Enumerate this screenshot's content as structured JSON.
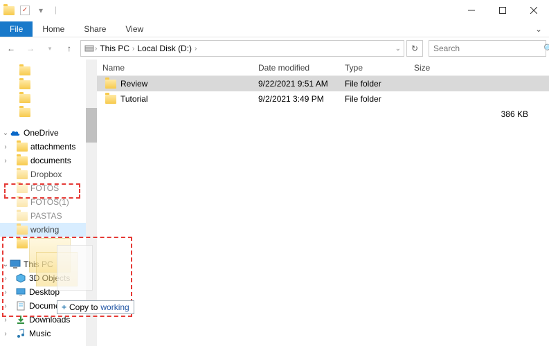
{
  "titlebar": {
    "qat": [
      "folder",
      "check",
      "pipe"
    ]
  },
  "ribbon": {
    "file": "File",
    "home": "Home",
    "share": "Share",
    "view": "View"
  },
  "nav": {
    "breadcrumb": [
      "This PC",
      "Local Disk (D:)"
    ],
    "search_placeholder": "Search"
  },
  "columns": {
    "name": "Name",
    "date": "Date modified",
    "type": "Type",
    "size": "Size"
  },
  "rows": [
    {
      "name": "Review",
      "date": "9/22/2021 9:51 AM",
      "type": "File folder",
      "size": "",
      "selected": true
    },
    {
      "name": "Tutorial",
      "date": "9/2/2021 3:49 PM",
      "type": "File folder",
      "size": ""
    }
  ],
  "summary_size": "386 KB",
  "tree": {
    "onedrive": "OneDrive",
    "attachments": "attachments",
    "documents": "documents",
    "dropbox": "Dropbox",
    "fotos": "FOTOS",
    "fotos1": "FOTOS(1)",
    "pastas": "PASTAS",
    "working": "working",
    "thispc": "This PC",
    "objects3d": "3D Objects",
    "desktop": "Desktop",
    "documents2": "Documents",
    "downloads": "Downloads",
    "music": "Music"
  },
  "drag": {
    "prefix": "Copy to ",
    "dest": "working"
  }
}
